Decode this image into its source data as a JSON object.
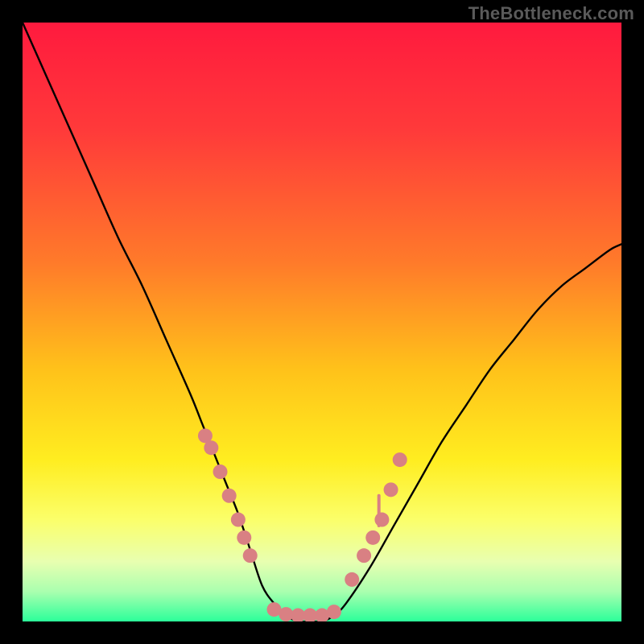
{
  "watermark": "TheBottleneck.com",
  "chart_data": {
    "type": "line",
    "title": "",
    "xlabel": "",
    "ylabel": "",
    "xlim": [
      0,
      100
    ],
    "ylim": [
      0,
      100
    ],
    "grid": false,
    "legend": false,
    "background": {
      "type": "vertical-gradient",
      "stops": [
        {
          "pos": 0.0,
          "color": "#ff1a3e"
        },
        {
          "pos": 0.18,
          "color": "#ff3a3a"
        },
        {
          "pos": 0.4,
          "color": "#ff7a2a"
        },
        {
          "pos": 0.58,
          "color": "#ffc21a"
        },
        {
          "pos": 0.73,
          "color": "#ffed20"
        },
        {
          "pos": 0.83,
          "color": "#fbff6a"
        },
        {
          "pos": 0.9,
          "color": "#e8ffb0"
        },
        {
          "pos": 0.95,
          "color": "#aaffaf"
        },
        {
          "pos": 1.0,
          "color": "#2bff9a"
        }
      ]
    },
    "series": [
      {
        "name": "bottleneck-curve",
        "type": "line",
        "color": "#000000",
        "x": [
          0,
          4,
          8,
          12,
          16,
          20,
          24,
          28,
          30,
          32,
          34,
          36,
          38,
          40,
          42,
          44,
          46,
          48,
          50,
          52,
          54,
          58,
          62,
          66,
          70,
          74,
          78,
          82,
          86,
          90,
          94,
          98,
          100
        ],
        "values": [
          100,
          91,
          82,
          73,
          64,
          56,
          47,
          38,
          33,
          28,
          23,
          18,
          12,
          6,
          3,
          1,
          0,
          0,
          0,
          1,
          3,
          9,
          16,
          23,
          30,
          36,
          42,
          47,
          52,
          56,
          59,
          62,
          63
        ]
      },
      {
        "name": "left-slope-dots",
        "type": "scatter",
        "color": "#d98083",
        "x": [
          30.5,
          31.5,
          33.0,
          34.5,
          36.0,
          37.0,
          38.0
        ],
        "values": [
          31.0,
          29.0,
          25.0,
          21.0,
          17.0,
          14.0,
          11.0
        ]
      },
      {
        "name": "right-slope-dots",
        "type": "scatter",
        "color": "#d98083",
        "x": [
          55.0,
          57.0,
          58.5,
          60.0,
          61.5,
          63.0
        ],
        "values": [
          7.0,
          11.0,
          14.0,
          17.0,
          22.0,
          27.0
        ]
      },
      {
        "name": "trough-dots",
        "type": "scatter",
        "color": "#d98083",
        "x": [
          42.0,
          44.0,
          46.0,
          48.0,
          50.0,
          52.0
        ],
        "values": [
          2.0,
          1.2,
          1.0,
          1.0,
          1.0,
          1.6
        ]
      }
    ],
    "annotations": [
      {
        "name": "vertical-tick",
        "type": "line",
        "color": "#d98083",
        "x": [
          59.5,
          59.5
        ],
        "y": [
          16.0,
          21.0
        ]
      }
    ]
  },
  "colors": {
    "dot": "#d98083",
    "curve": "#000000",
    "frame": "#000000"
  }
}
